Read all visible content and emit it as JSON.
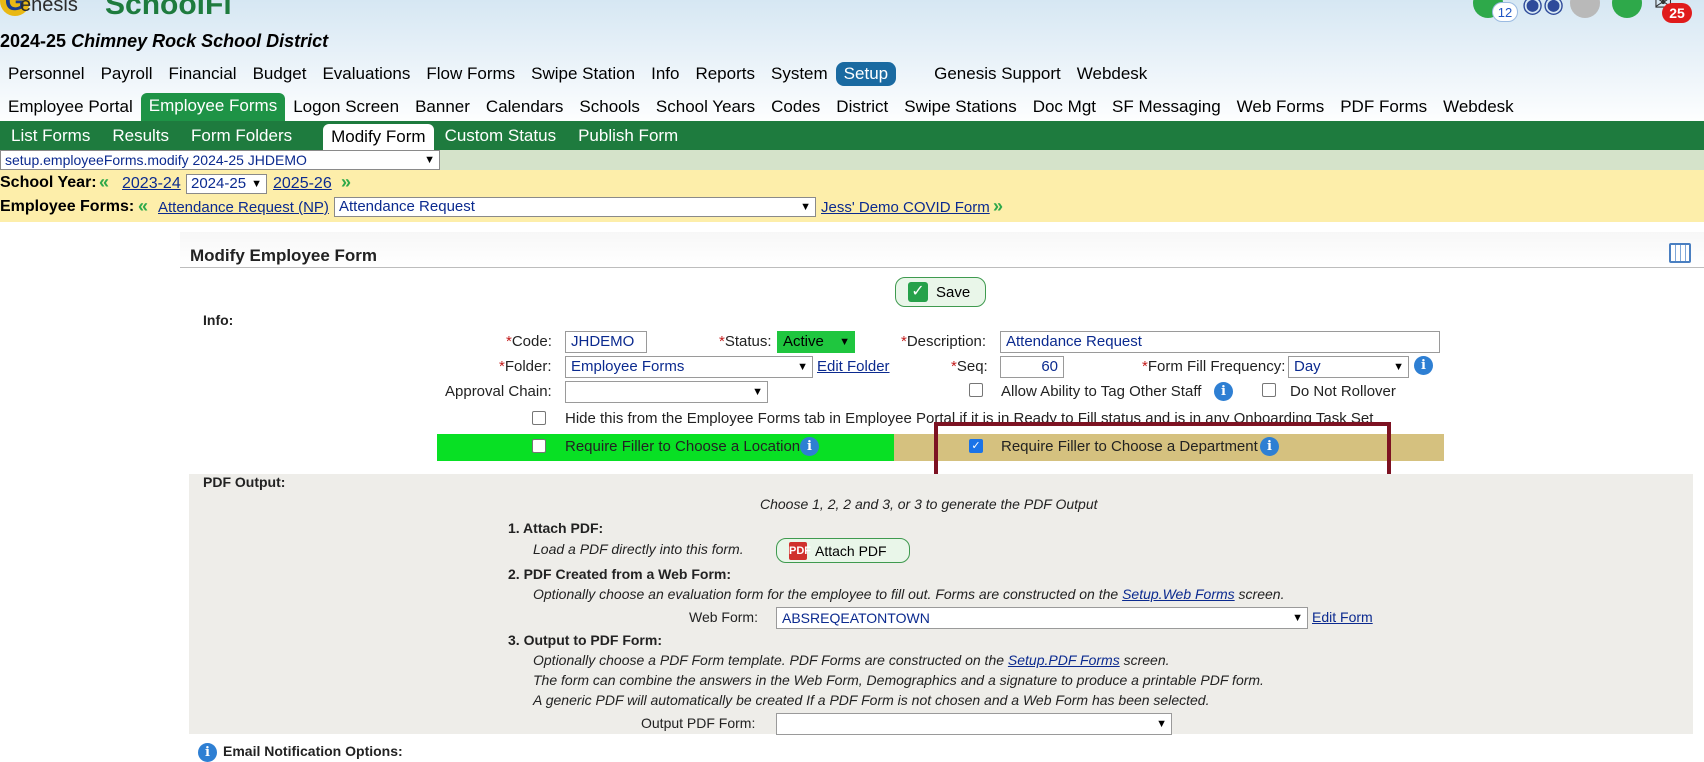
{
  "brand": {
    "logo_letter": "G",
    "genesis": "enesis",
    "product": "SchoolFi"
  },
  "district_year": "2024-25",
  "district_name": "Chimney Rock School District",
  "top_icons": {
    "help_badge": "12",
    "mail_badge": "25"
  },
  "menu1": [
    "Personnel",
    "Payroll",
    "Financial",
    "Budget",
    "Evaluations",
    "Flow Forms",
    "Swipe Station",
    "Info",
    "Reports",
    "System",
    "Setup",
    "Genesis Support",
    "Webdesk"
  ],
  "menu2": [
    "Employee Portal",
    "Employee Forms",
    "Logon Screen",
    "Banner",
    "Calendars",
    "Schools",
    "School Years",
    "Codes",
    "District",
    "Swipe Stations",
    "Doc Mgt",
    "SF Messaging",
    "Web Forms",
    "PDF Forms",
    "Webdesk"
  ],
  "menu3": [
    "List Forms",
    "Results",
    "Form Folders",
    "Modify Form",
    "Custom Status",
    "Publish Form"
  ],
  "path_select": "setup.employeeForms.modify 2024-25 JHDEMO",
  "school_year": {
    "label": "School Year:",
    "prev": "2023-24",
    "current": "2024-25",
    "next": "2025-26"
  },
  "employee_forms": {
    "label": "Employee Forms:",
    "prev": "Attendance Request (NP)",
    "current": "Attendance Request",
    "next": "Jess' Demo COVID Form"
  },
  "panel": {
    "title": "Modify Employee Form",
    "save": "Save"
  },
  "info": {
    "section": "Info:",
    "code_label": "Code:",
    "code": "JHDEMO",
    "status_label": "Status:",
    "status": "Active",
    "desc_label": "Description:",
    "desc": "Attendance Request",
    "folder_label": "Folder:",
    "folder": "Employee Forms",
    "edit_folder": "Edit Folder",
    "seq_label": "Seq:",
    "seq": "60",
    "freq_label": "Form Fill Frequency:",
    "freq": "Day",
    "approval_label": "Approval Chain:",
    "approval": "",
    "tag_staff": "Allow Ability to Tag Other Staff",
    "no_rollover": "Do Not Rollover",
    "hide_text": "Hide this from the Employee Forms tab in Employee Portal if it is in Ready to Fill status and is in any Onboarding Task Set",
    "req_location": "Require Filler to Choose a Location",
    "req_department": "Require Filler to Choose a Department"
  },
  "pdf": {
    "section": "PDF Output:",
    "intro": "Choose 1, 2, 2 and 3, or 3 to generate the PDF Output",
    "s1_title": "1. Attach PDF:",
    "s1_desc": "Load a PDF directly into this form.",
    "attach_btn": "Attach PDF",
    "pdf_icon": "PDF",
    "s2_title": "2. PDF Created from a Web Form:",
    "s2_desc_a": "Optionally choose an evaluation form for the employee to fill out. Forms are constructed on the",
    "s2_link": "Setup.Web Forms",
    "s2_desc_b": "screen.",
    "webform_label": "Web Form:",
    "webform": "ABSREQEATONTOWN",
    "edit_form": "Edit Form",
    "s3_title": "3. Output to PDF Form:",
    "s3_desc_a": "Optionally choose a PDF Form template. PDF Forms are constructed on the",
    "s3_link": "Setup.PDF Forms",
    "s3_desc_b": "screen.",
    "s3_line2": "The form can combine the answers in the Web Form, Demographics and a signature to produce a printable PDF form.",
    "s3_line3": "A generic PDF will automatically be created If a PDF Form is not chosen and a Web Form has been selected.",
    "output_label": "Output PDF Form:",
    "output": ""
  },
  "email_section": "Email Notification Options:",
  "colors": {
    "green_menu": "#1e7b3e",
    "setup_active": "#1a6aa1",
    "location_row": "#08e024",
    "department_row": "#d5c17f",
    "highlight_box": "#7d1222"
  }
}
